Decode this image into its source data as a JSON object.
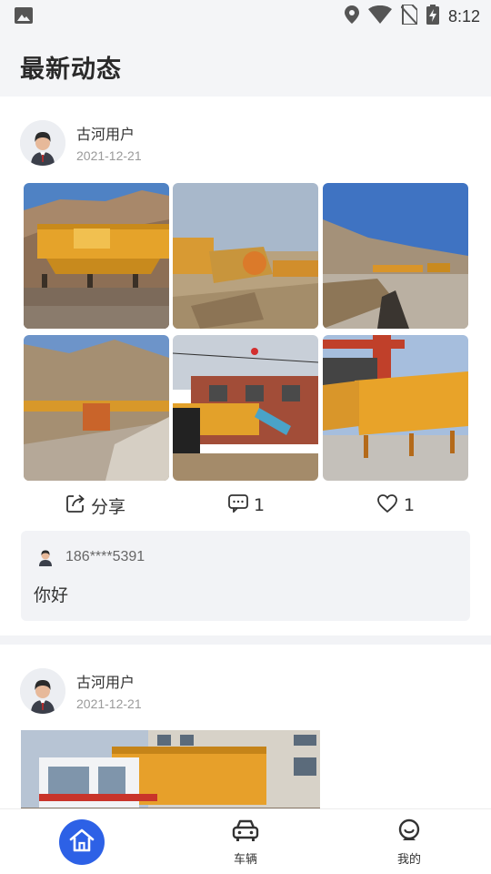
{
  "status_bar": {
    "time": "8:12",
    "icons": [
      "image-icon",
      "location-icon",
      "wifi-icon",
      "no-sim-icon",
      "battery-charging-icon"
    ]
  },
  "header": {
    "title": "最新动态"
  },
  "posts": [
    {
      "username": "古河用户",
      "date": "2021-12-21",
      "photos": 6,
      "actions": {
        "share_label": "分享",
        "comment_count": "1",
        "like_count": "1"
      },
      "comments": [
        {
          "user": "186****5391",
          "text": "你好"
        }
      ]
    },
    {
      "username": "古河用户",
      "date": "2021-12-21",
      "photos": 1
    }
  ],
  "bottom_nav": {
    "items": [
      {
        "label": "",
        "icon": "home-icon",
        "active": true
      },
      {
        "label": "车辆",
        "icon": "car-icon",
        "active": false
      },
      {
        "label": "我的",
        "icon": "profile-icon",
        "active": false
      }
    ]
  },
  "colors": {
    "accent": "#2d61e6",
    "background": "#f4f5f7",
    "machine_yellow": "#e9a326"
  }
}
